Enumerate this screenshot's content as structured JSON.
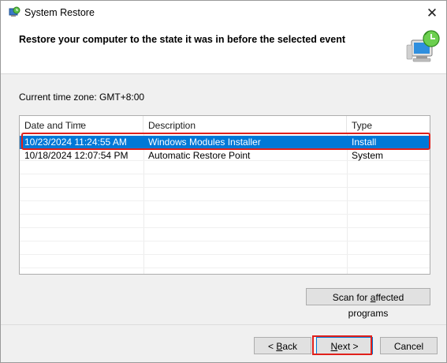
{
  "window": {
    "title": "System Restore",
    "close_symbol": "✕"
  },
  "header": {
    "title": "Restore your computer to the state it was in before the selected event"
  },
  "timezone": {
    "label": "Current time zone: GMT+8:00"
  },
  "table": {
    "columns": [
      "Date and Time",
      "Description",
      "Type"
    ],
    "sort_indicator": "⌄",
    "rows": [
      {
        "date": "10/23/2024 11:24:55 AM",
        "description": "Windows Modules Installer",
        "type": "Install",
        "selected": true
      },
      {
        "date": "10/18/2024 12:07:54 PM",
        "description": "Automatic Restore Point",
        "type": "System",
        "selected": false
      }
    ]
  },
  "buttons": {
    "scan_pre": "Scan for ",
    "scan_u": "a",
    "scan_post": "ffected programs",
    "back_pre": "< ",
    "back_u": "B",
    "back_post": "ack",
    "next_u": "N",
    "next_post": "ext >",
    "cancel": "Cancel"
  },
  "colors": {
    "selection": "#0078d7",
    "annotation_highlight": "#e0201b"
  },
  "icons": {
    "title_icon": "system-restore-icon",
    "header_icon": "computer-clock-restore-icon",
    "close_icon": "close-icon"
  }
}
